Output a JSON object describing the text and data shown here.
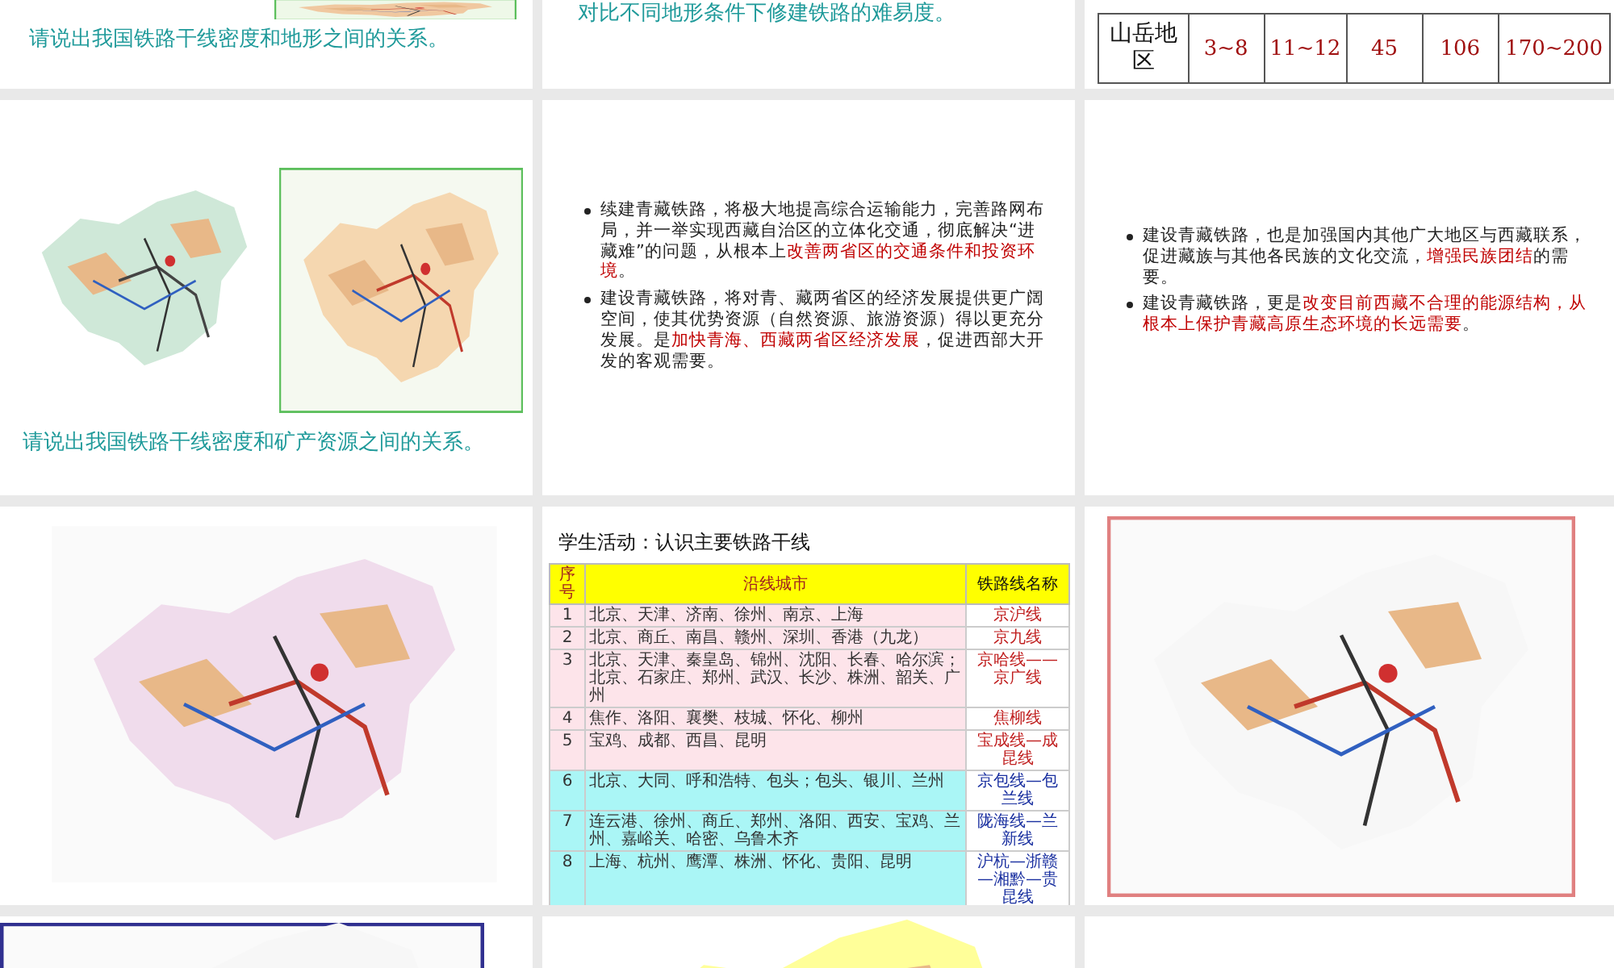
{
  "slides": [
    {
      "kind": "picture_caption",
      "caption": "请说出我国铁路干线密度和地形之间的关系。"
    },
    {
      "kind": "caption",
      "caption": "对比不同地形条件下修建铁路的难易度。"
    },
    {
      "kind": "table_fragment",
      "row_label": "山岳地区",
      "cells": [
        "3~8",
        "11~12",
        "45",
        "106",
        "170~200"
      ]
    },
    {
      "kind": "maps_caption",
      "caption": "请说出我国铁路干线密度和矿产资源之间的关系。"
    },
    {
      "kind": "bullets",
      "bullets": [
        [
          {
            "text": "续建青藏铁路，将极大地提高综合运输能力，完善路网布局，并一举实现西藏自治区的立体化交通，彻底解决“进藏难”的问题，从根本上",
            "highlight": false
          },
          {
            "text": "改善两省区的交通条件和投资环境",
            "highlight": true
          },
          {
            "text": "。",
            "highlight": false
          }
        ],
        [
          {
            "text": "建设青藏铁路，将对青、藏两省区的经济发展提供更广阔空间，使其优势资源（自然资源、旅游资源）得以更充分发展。是",
            "highlight": false
          },
          {
            "text": "加快青海、西藏两省区经济发展",
            "highlight": true
          },
          {
            "text": "，促进西部大开发的客观需要。",
            "highlight": false
          }
        ]
      ]
    },
    {
      "kind": "bullets",
      "bullets": [
        [
          {
            "text": "建设青藏铁路，也是加强国内其他广大地区与西藏联系，促进藏族与其他各民族的文化交流，",
            "highlight": false
          },
          {
            "text": "增强民族团结",
            "highlight": true
          },
          {
            "text": "的需要。",
            "highlight": false
          }
        ],
        [
          {
            "text": "建设青藏铁路，更是",
            "highlight": false
          },
          {
            "text": "改变目前西藏不合理的能源结构，从根本上保护青藏高原生态环境的长远需要",
            "highlight": true
          },
          {
            "text": "。",
            "highlight": false
          }
        ]
      ]
    },
    {
      "kind": "picture"
    },
    {
      "kind": "table",
      "title": "学生活动：认识主要铁路干线",
      "columns": [
        "序号",
        "沿线城市",
        "铁路线名称"
      ],
      "rows": [
        {
          "kind": "warm",
          "cells": [
            "1",
            "北京、天津、济南、徐州、南京、上海",
            "京沪线"
          ]
        },
        {
          "kind": "warm",
          "cells": [
            "2",
            "北京、商丘、南昌、赣州、深圳、香港（九龙）",
            "京九线"
          ]
        },
        {
          "kind": "warm",
          "cells": [
            "3",
            "北京、天津、秦皇岛、锦州、沈阳、长春、哈尔滨；北京、石家庄、郑州、武汉、长沙、株洲、韶关、广州",
            "京哈线——京广线"
          ]
        },
        {
          "kind": "warm",
          "cells": [
            "4",
            "焦作、洛阳、襄樊、枝城、怀化、柳州",
            "焦柳线"
          ]
        },
        {
          "kind": "warm",
          "cells": [
            "5",
            "宝鸡、成都、西昌、昆明",
            "宝成线—成昆线"
          ]
        },
        {
          "kind": "cool",
          "cells": [
            "6",
            "北京、大同、呼和浩特、包头；包头、银川、兰州",
            "京包线—包兰线"
          ]
        },
        {
          "kind": "cool",
          "cells": [
            "7",
            "连云港、徐州、商丘、郑州、洛阳、西安、宝鸡、兰州、嘉峪关、哈密、乌鲁木齐",
            "陇海线—兰新线"
          ]
        },
        {
          "kind": "cool",
          "cells": [
            "8",
            "上海、杭州、鹰潭、株洲、怀化、贵阳、昆明",
            "沪杭—浙赣—湘黔—贵昆线"
          ]
        }
      ]
    },
    {
      "kind": "picture"
    },
    {
      "kind": "picture"
    },
    {
      "kind": "picture"
    },
    {
      "kind": "blank"
    }
  ]
}
